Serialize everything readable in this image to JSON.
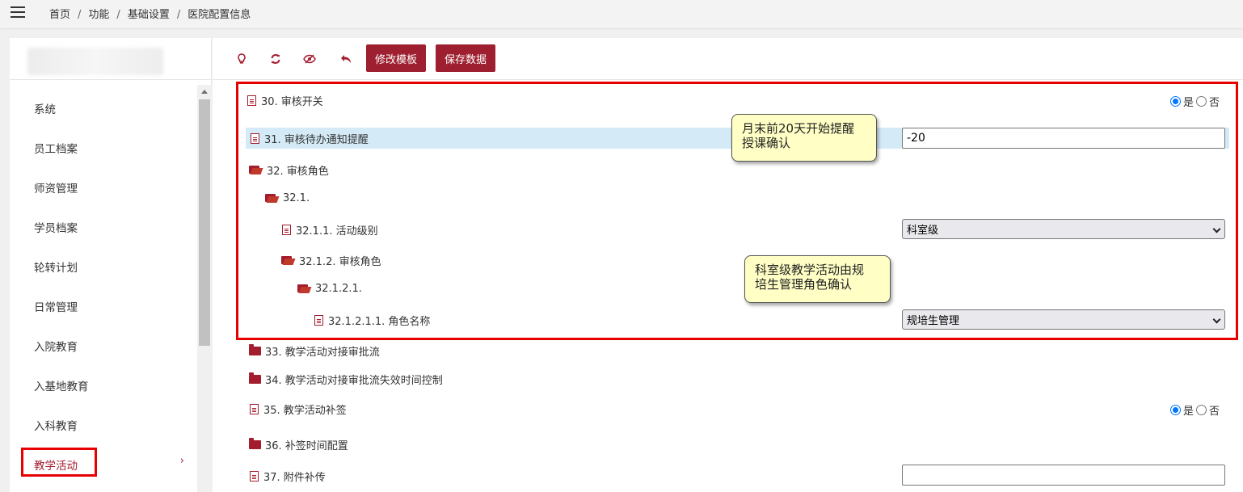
{
  "breadcrumb": [
    "首页",
    "功能",
    "基础设置",
    "医院配置信息"
  ],
  "breadcrumb_sep": "/",
  "sidebar": {
    "items": [
      {
        "label": "系统"
      },
      {
        "label": "员工档案"
      },
      {
        "label": "师资管理"
      },
      {
        "label": "学员档案"
      },
      {
        "label": "轮转计划"
      },
      {
        "label": "日常管理"
      },
      {
        "label": "入院教育"
      },
      {
        "label": "入基地教育"
      },
      {
        "label": "入科教育"
      },
      {
        "label": "教学活动",
        "active": true,
        "chevron": "›"
      }
    ]
  },
  "toolbar": {
    "icons": [
      "lightbulb-icon",
      "refresh-icon",
      "eye-slash-icon",
      "undo-icon"
    ],
    "edit_template_label": "修改模板",
    "save_data_label": "保存数据"
  },
  "config": {
    "r30": {
      "label": "30. 审核开关",
      "yes": "是",
      "no": "否",
      "selected": "是"
    },
    "r31": {
      "label": "31. 审核待办通知提醒",
      "value": "-20"
    },
    "r32": {
      "label": "32. 审核角色"
    },
    "r32_1": {
      "label": "32.1."
    },
    "r32_1_1": {
      "label": "32.1.1. 活动级别",
      "value": "科室级"
    },
    "r32_1_2": {
      "label": "32.1.2. 审核角色"
    },
    "r32_1_2_1": {
      "label": "32.1.2.1."
    },
    "r32_1_2_1_1": {
      "label": "32.1.2.1.1. 角色名称",
      "value": "规培生管理"
    },
    "r33": {
      "label": "33. 教学活动对接审批流"
    },
    "r34": {
      "label": "34. 教学活动对接审批流失效时间控制"
    },
    "r35": {
      "label": "35. 教学活动补签",
      "yes": "是",
      "no": "否",
      "selected": "是"
    },
    "r36": {
      "label": "36. 补签时间配置"
    },
    "r37": {
      "label": "37. 附件补传",
      "value": ""
    }
  },
  "tooltips": {
    "t1_line1": "月末前20天开始提醒",
    "t1_line2": "授课确认",
    "t2_line1": "科室级教学活动由规",
    "t2_line2": "培生管理角色确认"
  },
  "colors": {
    "accent": "#9e1f2f",
    "highlight": "#d4ebf7",
    "annotation": "#e60000",
    "tooltip": "#ffffc5"
  }
}
